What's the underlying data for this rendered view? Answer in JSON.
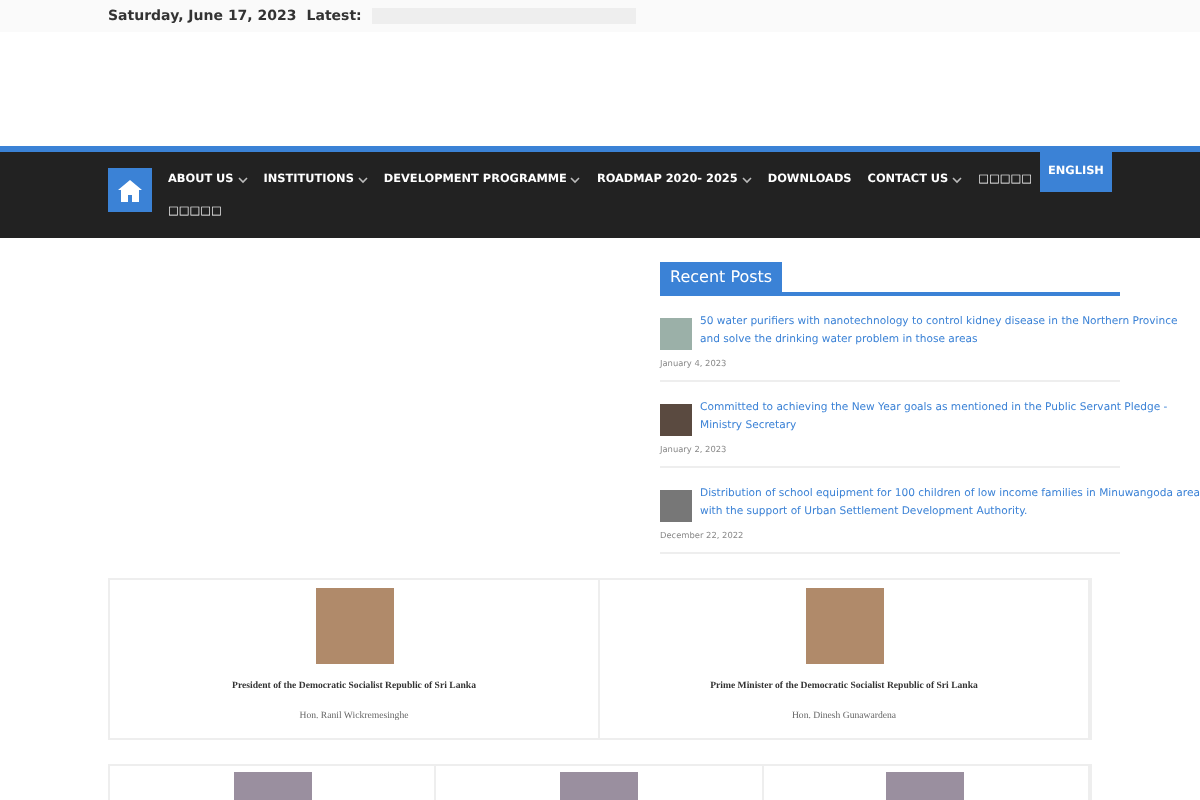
{
  "top_bar": {
    "date": "Saturday, June 17, 2023",
    "latest_label": "Latest:"
  },
  "nav": {
    "items": [
      {
        "label": "ABOUT US",
        "dropdown": true,
        "selected": false
      },
      {
        "label": "INSTITUTIONS",
        "dropdown": true,
        "selected": false
      },
      {
        "label": "DEVELOPMENT PROGRAMME",
        "dropdown": true,
        "selected": false
      },
      {
        "label": "ROADMAP 2020- 2025",
        "dropdown": true,
        "selected": false
      },
      {
        "label": "DOWNLOADS",
        "dropdown": false,
        "selected": false
      },
      {
        "label": "CONTACT US",
        "dropdown": true,
        "selected": false
      },
      {
        "label": "□□□□□",
        "dropdown": false,
        "selected": false
      },
      {
        "label": "ENGLISH",
        "dropdown": false,
        "selected": true
      },
      {
        "label": "□□□□□",
        "dropdown": false,
        "selected": false
      }
    ]
  },
  "recent_posts": {
    "title": "Recent Posts",
    "posts": [
      {
        "title": "50 water purifiers with nanotechnology to control kidney disease in the Northern Province and solve the drinking water problem in those areas",
        "date": "January 4, 2023"
      },
      {
        "title": "Committed to achieving the New Year goals as mentioned in the Public Servant Pledge - Ministry Secretary",
        "date": "January 2, 2023"
      },
      {
        "title": "Distribution of school equipment for 100 children of low income families in Minuwangoda area with the support of Urban Settlement Development Authority.",
        "date": "December 22, 2022"
      }
    ]
  },
  "leaders": [
    {
      "role": "President of the Democratic Socialist Republic of Sri Lanka",
      "name": "Hon. Ranil Wickremesinghe"
    },
    {
      "role": "Prime Minister of the Democratic Socialist Republic of Sri Lanka",
      "name": "Hon. Dinesh Gunawardena"
    }
  ]
}
